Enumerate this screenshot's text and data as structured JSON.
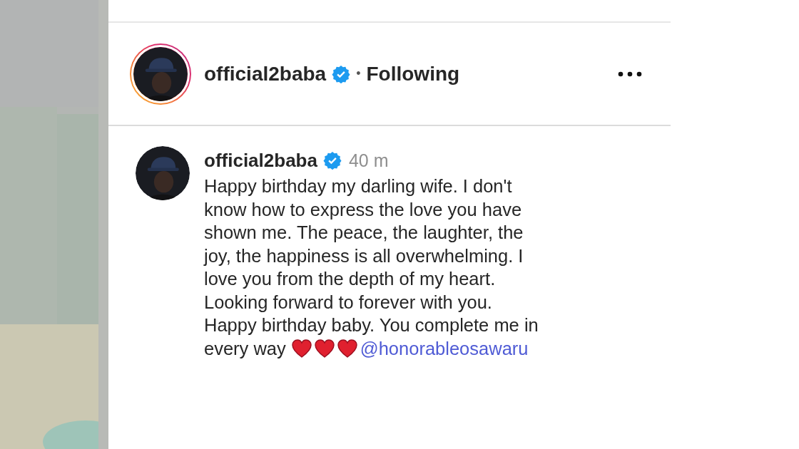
{
  "post_header": {
    "username": "official2baba",
    "verified": true,
    "story_ring": true,
    "separator": "•",
    "follow_status": "Following"
  },
  "comment": {
    "username": "official2baba",
    "verified": true,
    "time": "40 m",
    "caption_lines": [
      "Happy birthday my darling wife. I don't",
      "know how to express the love you have",
      "shown me. The peace, the laughter, the",
      "joy, the happiness is all overwhelming. I",
      "love you from the depth of my heart.",
      "Looking forward to forever with you.",
      "Happy birthday baby. You complete me in",
      "every way"
    ],
    "mention": "@honorableosawaru"
  }
}
